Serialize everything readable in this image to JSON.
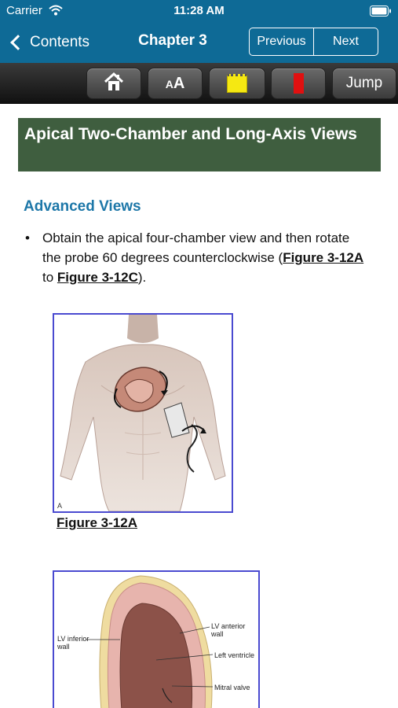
{
  "status_bar": {
    "carrier": "Carrier",
    "time": "11:28 AM"
  },
  "nav": {
    "back_label": "Contents",
    "title": "Chapter 3",
    "previous_label": "Previous",
    "next_label": "Next"
  },
  "toolbar": {
    "font_small": "A",
    "font_big": "A",
    "jump_label": "Jump",
    "icons": [
      "home-icon",
      "font-size-icon",
      "yellow-note-icon",
      "red-bookmark-icon"
    ]
  },
  "content": {
    "section_title": "Apical Two-Chamber and Long-Axis Views",
    "subheading": "Advanced Views",
    "bullet": {
      "text_before": "Obtain the apical four-chamber view and then rotate the probe 60 degrees counterclockwise (",
      "link1": "Figure 3-12A",
      "text_mid": " to ",
      "link2": "Figure 3-12C",
      "text_after": ")."
    },
    "figure_a": {
      "corner_label": "A",
      "caption": "Figure 3-12A"
    },
    "figure_b": {
      "labels": {
        "lv_anterior": "LV anterior wall",
        "lv_inferior": "LV inferior wall",
        "left_ventricle": "Left ventricle",
        "mitral_valve": "Mitral valve"
      }
    }
  },
  "colors": {
    "nav_blue": "#0e6a96",
    "header_green": "#3f5e3f",
    "subhead_blue": "#1d77a8",
    "figure_border": "#4a4ad0"
  }
}
